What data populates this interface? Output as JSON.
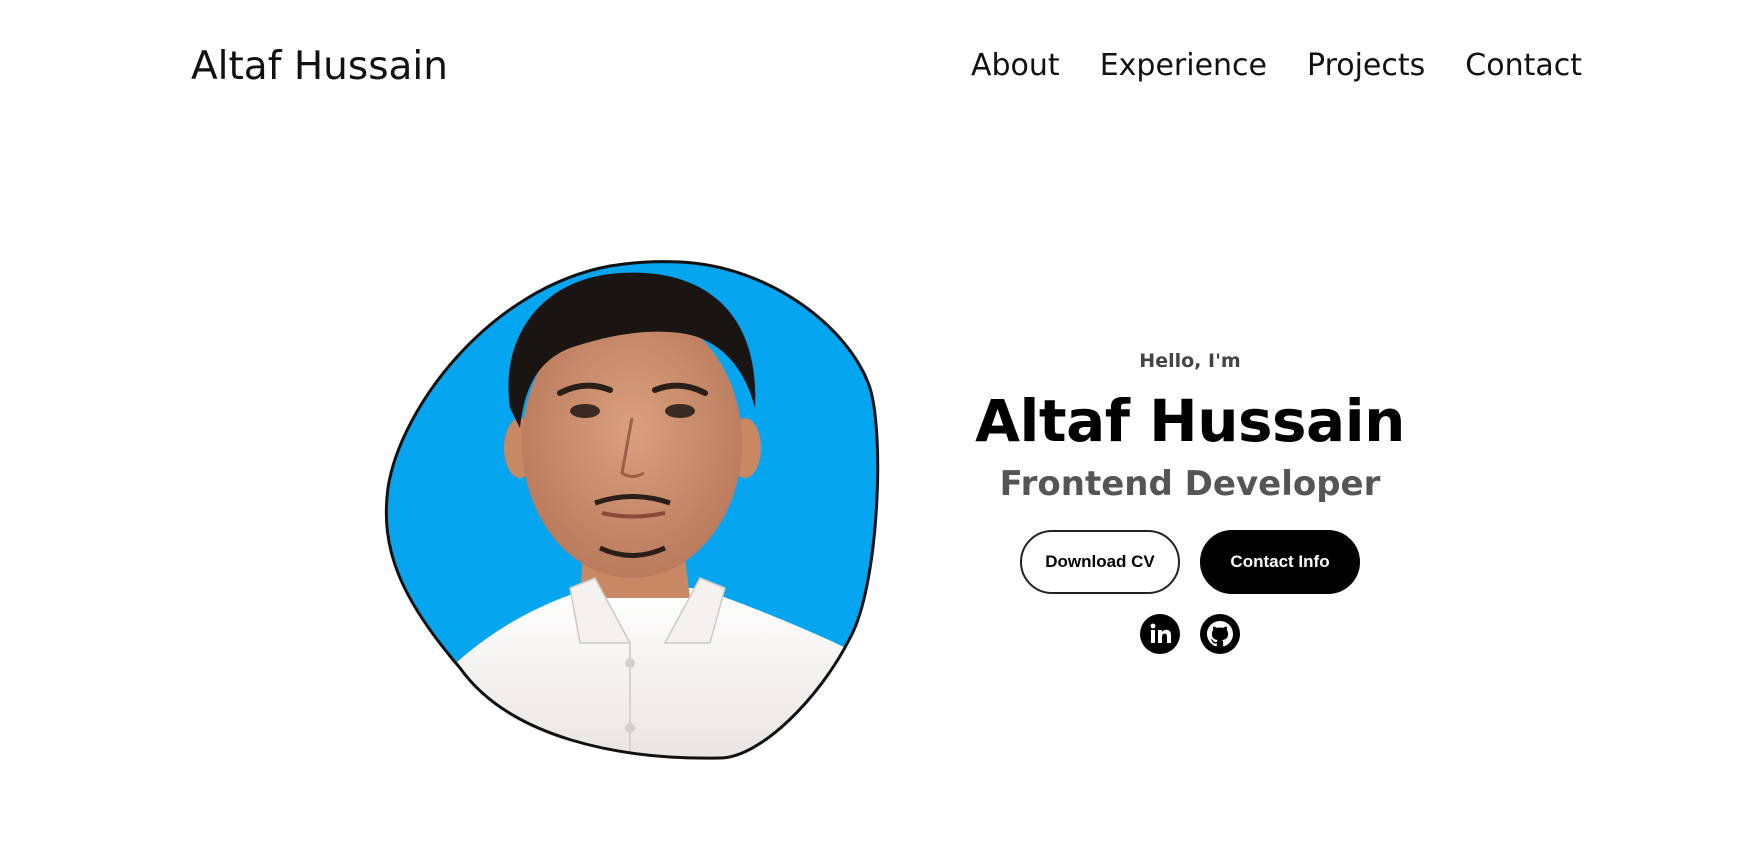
{
  "header": {
    "logo": "Altaf Hussain",
    "nav": [
      "About",
      "Experience",
      "Projects",
      "Contact"
    ]
  },
  "hero": {
    "greeting": "Hello, I'm",
    "name": "Altaf Hussain",
    "role": "Frontend Developer",
    "buttons": {
      "download": "Download CV",
      "contact": "Contact Info"
    },
    "socials": {
      "linkedin_icon": "linkedin-icon",
      "github_icon": "github-icon"
    }
  },
  "colors": {
    "photo_background": "#05a5f0",
    "text_primary": "#000000",
    "text_secondary": "#555555"
  }
}
